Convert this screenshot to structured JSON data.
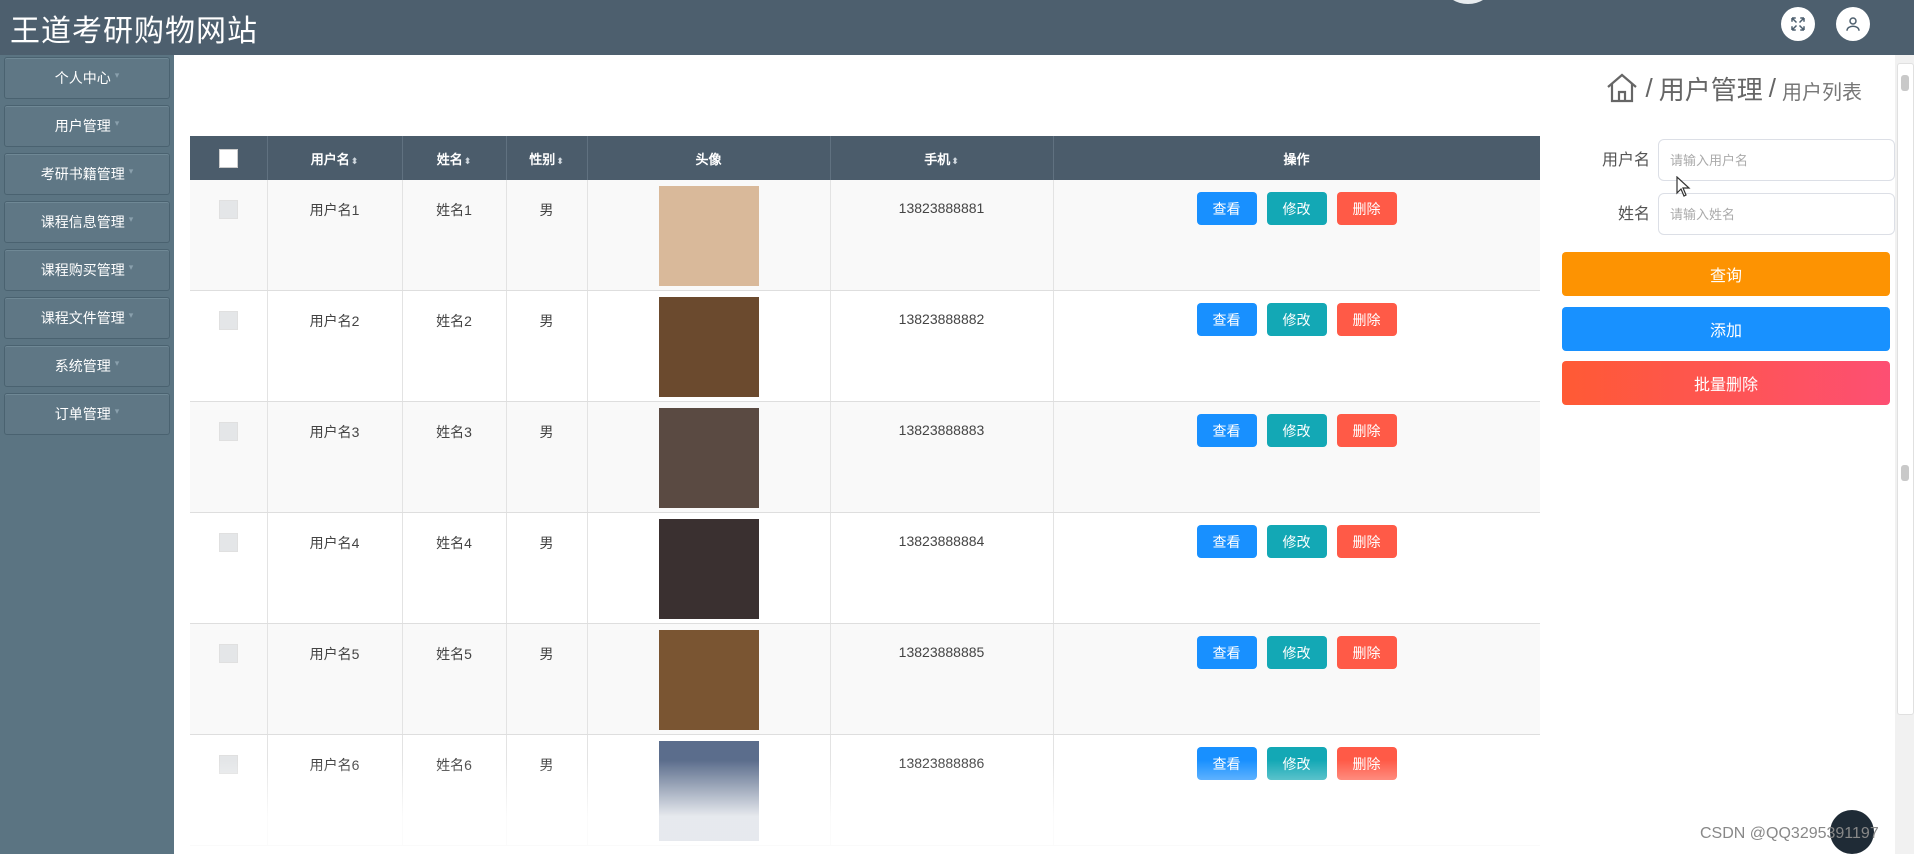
{
  "header": {
    "title": "王道考研购物网站"
  },
  "sidebar": {
    "items": [
      {
        "label": "个人中心"
      },
      {
        "label": "用户管理"
      },
      {
        "label": "考研书籍管理"
      },
      {
        "label": "课程信息管理"
      },
      {
        "label": "课程购买管理"
      },
      {
        "label": "课程文件管理"
      },
      {
        "label": "系统管理"
      },
      {
        "label": "订单管理"
      }
    ],
    "caret": "▾"
  },
  "breadcrumb": {
    "sep": "/",
    "parent": "用户管理",
    "current": "用户列表"
  },
  "table": {
    "columns": {
      "username": "用户名",
      "name": "姓名",
      "gender": "性别",
      "avatar": "头像",
      "phone": "手机",
      "actions": "操作"
    },
    "sort_icon": "⬍",
    "rows": [
      {
        "username": "用户名1",
        "name": "姓名1",
        "gender": "男",
        "phone": "13823888881",
        "avatar_color": "#d9b99a"
      },
      {
        "username": "用户名2",
        "name": "姓名2",
        "gender": "男",
        "phone": "13823888882",
        "avatar_color": "#6b4a2e"
      },
      {
        "username": "用户名3",
        "name": "姓名3",
        "gender": "男",
        "phone": "13823888883",
        "avatar_color": "#5a4a42"
      },
      {
        "username": "用户名4",
        "name": "姓名4",
        "gender": "男",
        "phone": "13823888884",
        "avatar_color": "#3a3030"
      },
      {
        "username": "用户名5",
        "name": "姓名5",
        "gender": "男",
        "phone": "13823888885",
        "avatar_color": "#7a5532"
      },
      {
        "username": "用户名6",
        "name": "姓名6",
        "gender": "男",
        "phone": "13823888886",
        "avatar_color": "#5b6d8c"
      }
    ],
    "actions": {
      "view": "查看",
      "edit": "修改",
      "delete": "删除"
    }
  },
  "search": {
    "username_label": "用户名",
    "username_placeholder": "请输入用户名",
    "name_label": "姓名",
    "name_placeholder": "请输入姓名",
    "query_label": "查询",
    "add_label": "添加",
    "batch_delete_label": "批量删除"
  },
  "watermark": "CSDN @QQ3295391197",
  "colors": {
    "header": "#4d5f6e",
    "sidebar": "#5b7482",
    "view": "#1890ff",
    "edit": "#13a8b5",
    "delete": "#ff5a47",
    "query": "#fd9302",
    "add": "#1891ff",
    "batch_delete": "#ff5a34"
  }
}
